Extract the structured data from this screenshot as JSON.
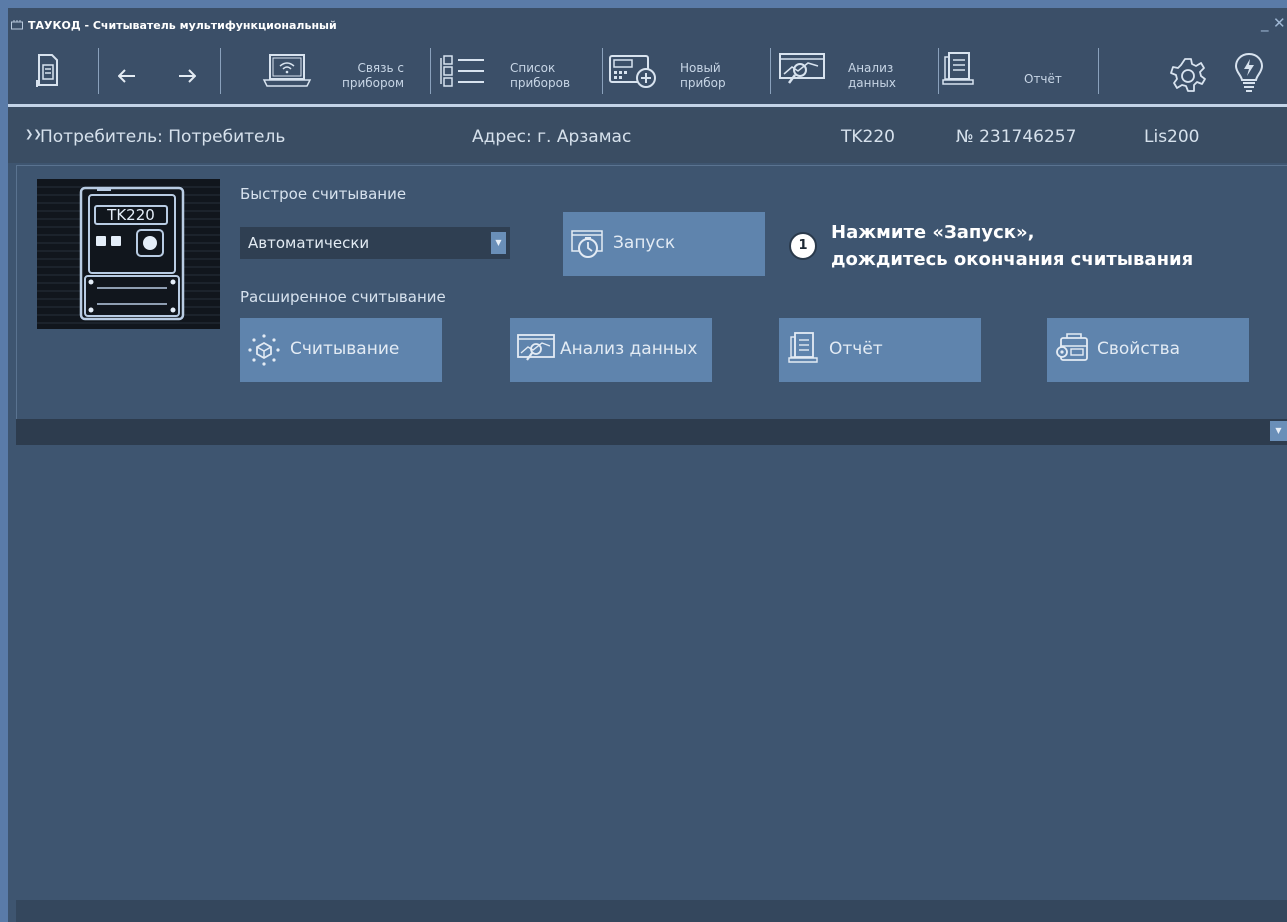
{
  "window": {
    "title": "ТАУКОД - Считыватель мультифункциональный",
    "minimize": "_",
    "close": "✕"
  },
  "toolbar": {
    "connect": "Связь с\nприбором",
    "device_list": "Список\nприборов",
    "new_device": "Новый\nприбор",
    "analysis": "Анализ\nданных",
    "report": "Отчёт"
  },
  "info": {
    "consumer": "Потребитель: Потребитель",
    "address": "Адрес: г. Арзамас",
    "model": "TK220",
    "number": "№ 231746257",
    "protocol": "Lis200"
  },
  "device_image_text": "TK220",
  "quick_read": {
    "label": "Быстрое считывание",
    "mode_value": "Автоматически",
    "start_label": "Запуск"
  },
  "extended_read": {
    "label": "Расширенное считывание",
    "read_label": "Считывание",
    "analysis_label": "Анализ данных",
    "report_label": "Отчёт",
    "properties_label": "Свойства"
  },
  "hint": {
    "step": "1",
    "line1": "Нажмите «Запуск»,",
    "line2": "дождитесь окончания считывания"
  },
  "colors": {
    "background": "#3e5570",
    "button": "#5f84ad",
    "toolbar": "#3b4f68",
    "accent": "#c3d4e8"
  }
}
